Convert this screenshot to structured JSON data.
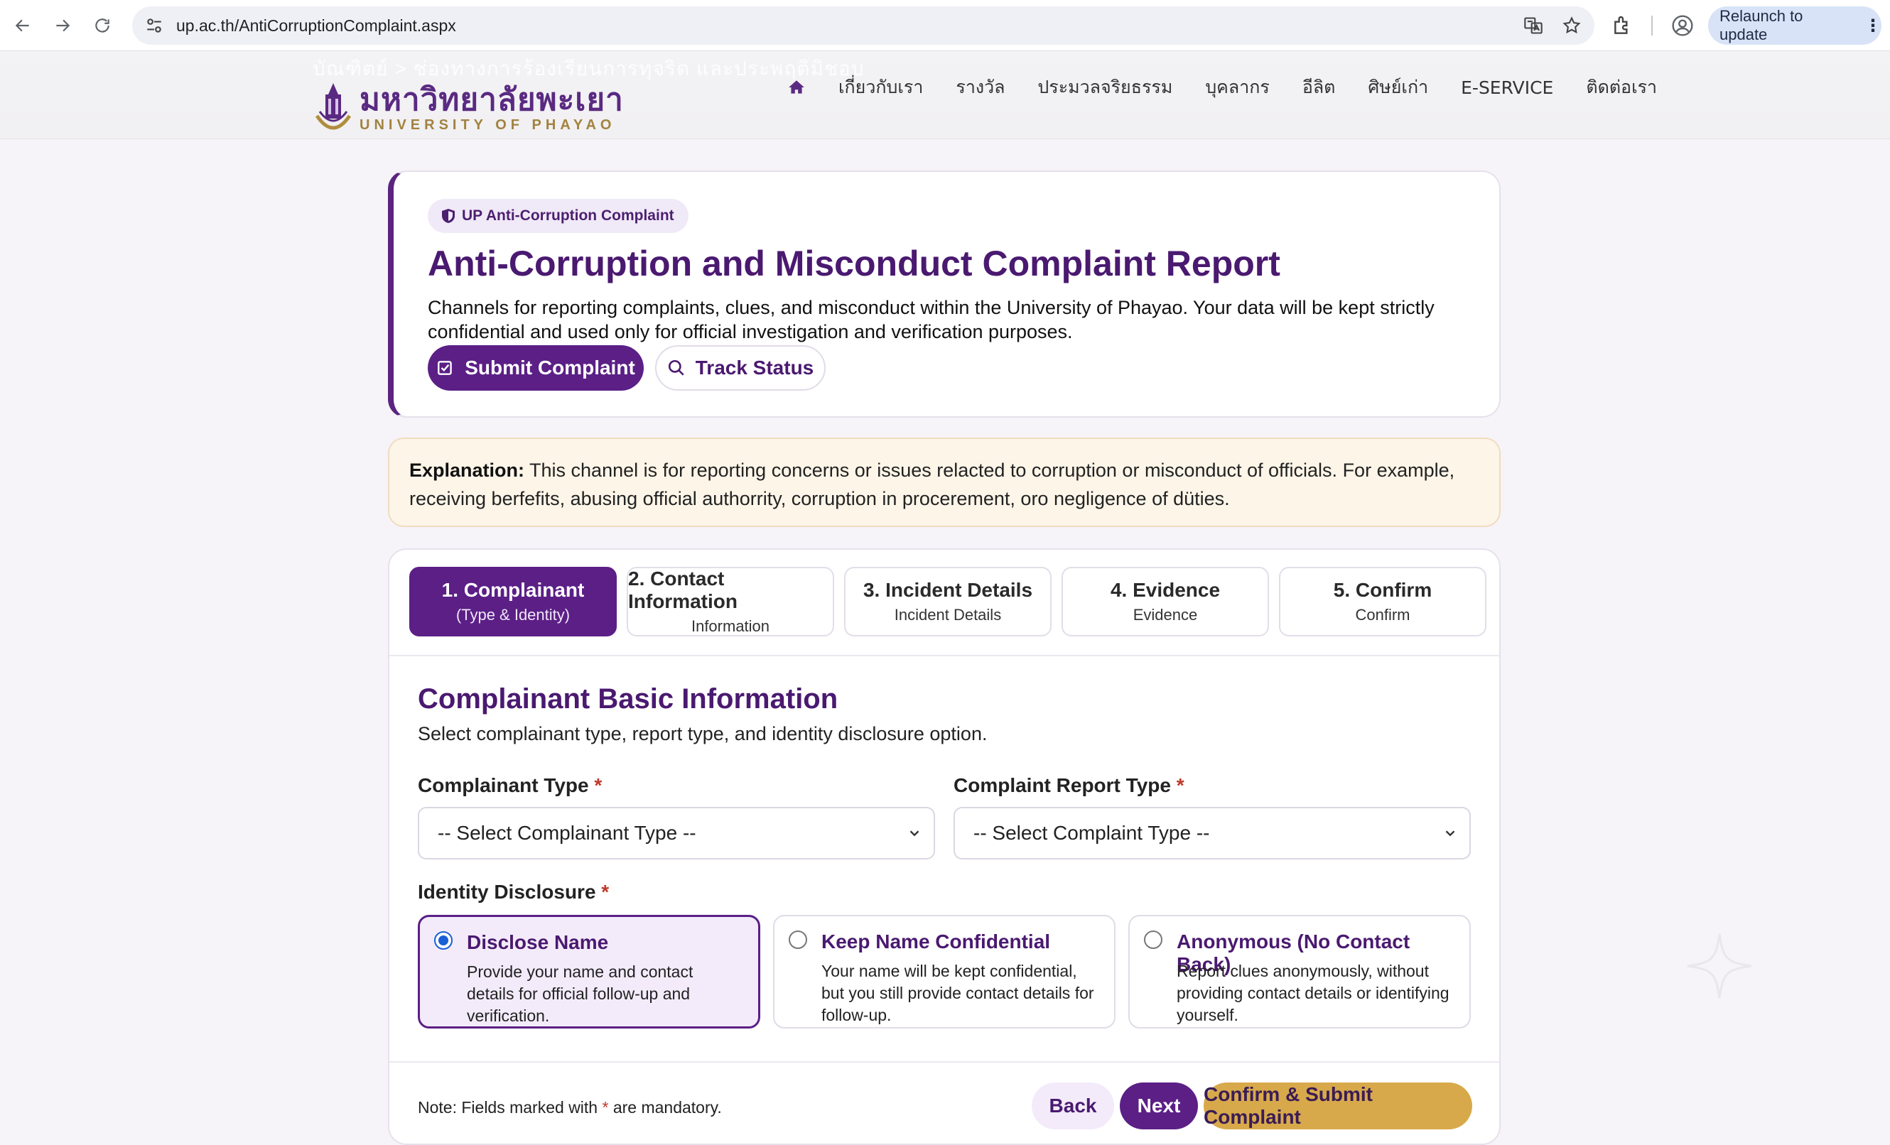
{
  "browser": {
    "url": "up.ac.th/AntiCorruptionComplaint.aspx",
    "relaunch_label": "Relaunch to update"
  },
  "site": {
    "ghost_text": "บัณฑิตย์ > ช่องทางการร้องเรียนการทุจริต และประพฤติมิชอบ",
    "logo_thai": "มหาวิทยาลัยพะเยา",
    "logo_eng": "UNIVERSITY OF PHAYAO",
    "nav": [
      "เกี่ยวกับเรา",
      "รางวัล",
      "ประมวลจริยธรรม",
      "บุคลากร",
      "อีลิต",
      "ศิษย์เก่า",
      "E-SERVICE",
      "ติดต่อเรา"
    ]
  },
  "hero": {
    "tag": "UP Anti-Corruption Complaint",
    "title": "Anti-Corruption and Misconduct Complaint Report",
    "description": "Channels for reporting complaints, clues, and misconduct within the University of Phayao. Your data will be kept strictly confidential and used only for official investigation and verification purposes.",
    "submit_label": "Submit Complaint",
    "track_label": "Track Status"
  },
  "explanation": {
    "label": "Explanation:",
    "text": " This channel is for reporting concerns or issues relacted to corruption or misconduct of officials. For example, receiving berfefits, abusing official authorrity, corruption in procerement, oro negligence of düties."
  },
  "steps": [
    {
      "title": "1. Complainant",
      "sub": "(Type & Identity)"
    },
    {
      "title": "2. Contact Information",
      "sub": "Information"
    },
    {
      "title": "3. Incident Details",
      "sub": "Incident Details"
    },
    {
      "title": "4. Evidence",
      "sub": "Evidence"
    },
    {
      "title": "5. Confirm",
      "sub": "Confirm"
    }
  ],
  "section": {
    "title": "Complainant Basic Information",
    "subtitle": "Select complainant type, report type, and identity disclosure option."
  },
  "fields": {
    "complainant_type_label": "Complainant Type",
    "complainant_type_value": "-- Select Complainant Type --",
    "report_type_label": "Complaint Report Type",
    "report_type_value": "-- Select Complaint Type --",
    "identity_label": "Identity Disclosure",
    "required_mark": "*"
  },
  "identity_options": [
    {
      "title": "Disclose Name",
      "desc": "Provide your name and contact details for official follow-up and verification.",
      "selected": true
    },
    {
      "title": "Keep Name Confidential",
      "desc": "Your name will be kept confidential, but you still provide contact details for follow-up.",
      "selected": false
    },
    {
      "title": "Anonymous (No Contact Back)",
      "desc": "Report clues anonymously, without providing contact details or identifying yourself.",
      "selected": false
    }
  ],
  "footer": {
    "note_prefix": "Note: Fields marked with ",
    "note_suffix": " are mandatory.",
    "back_label": "Back",
    "next_label": "Next",
    "confirm_label": "Confirm & Submit Complaint"
  },
  "colors": {
    "brand_purple": "#5b1f86",
    "gold": "#d8a94a",
    "required_red": "#c0392b"
  }
}
